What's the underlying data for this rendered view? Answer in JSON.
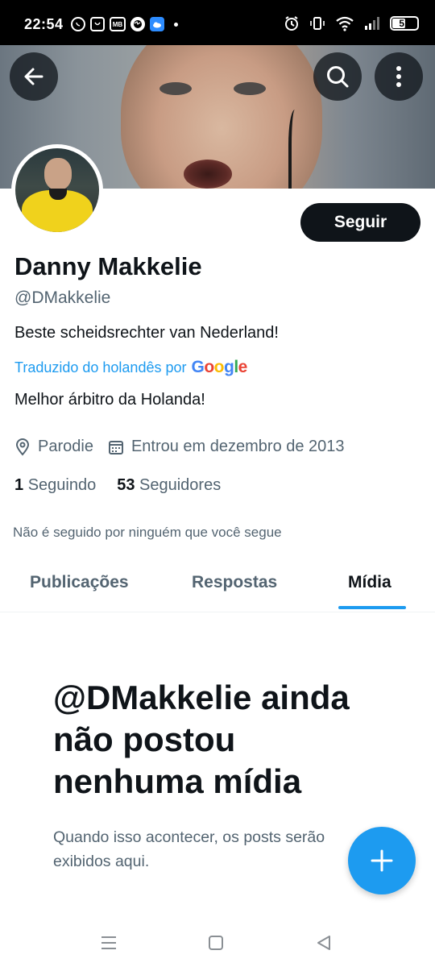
{
  "status_bar": {
    "time": "22:54",
    "battery": "51",
    "app_icons": [
      "whatsapp-icon",
      "smiley-app-icon",
      "mb-app-icon",
      "globe-icon",
      "cloud-app-icon"
    ],
    "mb_label": "MB"
  },
  "header": {
    "back_icon": "arrow-left-icon",
    "search_icon": "search-icon",
    "more_icon": "more-vertical-icon"
  },
  "profile": {
    "name": "Danny Makkelie",
    "handle": "@DMakkelie",
    "bio": "Beste scheidsrechter van Nederland!",
    "translated_label": "Traduzido do holandês por",
    "translated_bio": "Melhor árbitro da Holanda!",
    "follow_button": "Seguir",
    "location": "Parodie",
    "joined": "Entrou em dezembro de 2013",
    "following_count": "1",
    "following_label": "Seguindo",
    "followers_count": "53",
    "followers_label": "Seguidores",
    "not_followed_text": "Não é seguido por ninguém que você segue"
  },
  "google_logo": {
    "g1": "G",
    "o1": "o",
    "o2": "o",
    "g2": "g",
    "l": "l",
    "e": "e"
  },
  "tabs": [
    {
      "label": "Publicações",
      "active": false
    },
    {
      "label": "Respostas",
      "active": false
    },
    {
      "label": "Mídia",
      "active": true
    }
  ],
  "empty_state": {
    "title": "@DMakkelie ainda não postou nenhuma mídia",
    "subtitle": "Quando isso acontecer, os posts serão exibidos aqui."
  },
  "colors": {
    "accent": "#1d9bf0",
    "text_primary": "#0f1419",
    "text_secondary": "#536471",
    "button_dark": "#0f1419"
  }
}
